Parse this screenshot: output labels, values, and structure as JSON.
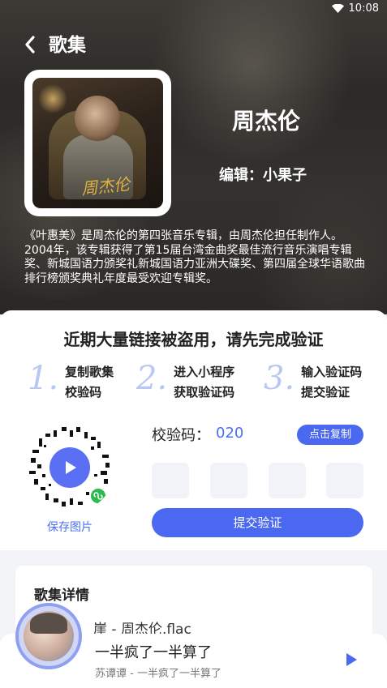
{
  "status": {
    "time": "10:08"
  },
  "header": {
    "title": "歌集"
  },
  "album": {
    "cover_text": "周杰伦",
    "artist": "周杰伦",
    "editor_label": "编辑：小果子",
    "description": "《叶惠美》是周杰伦的第四张音乐专辑，由周杰伦担任制作人。2004年，该专辑获得了第15届台湾金曲奖最佳流行音乐演唱专辑奖、新城国语力颁奖礼新城国语力亚洲大碟奖、第四届全球华语歌曲排行榜颁奖典礼年度最受欢迎专辑奖。"
  },
  "verify": {
    "title": "近期大量链接被盗用，请先完成验证",
    "steps": [
      {
        "num": "1.",
        "line1": "复制歌集",
        "line2": "校验码"
      },
      {
        "num": "2.",
        "line1": "进入小程序",
        "line2": "获取验证码"
      },
      {
        "num": "3.",
        "line1": "输入验证码",
        "line2": "提交验证"
      }
    ],
    "save_image": "保存图片",
    "code_label": "校验码：",
    "code_value": "020",
    "copy_button": "点击复制",
    "submit_button": "提交验证"
  },
  "details": {
    "title": "歌集详情",
    "first_item": "崖 - 周杰伦.flac"
  },
  "player": {
    "song": "一半疯了一半算了",
    "artist": "苏谭谭 - 一半疯了一半算了"
  },
  "colors": {
    "accent": "#4b68f0",
    "step_number": "#b9c8f3",
    "wechat_green": "#2db94d"
  },
  "icons": {
    "back": "chevron-left-icon",
    "wifi": "wifi-icon",
    "play": "play-icon",
    "miniprogram": "wechat-miniprogram-icon"
  }
}
